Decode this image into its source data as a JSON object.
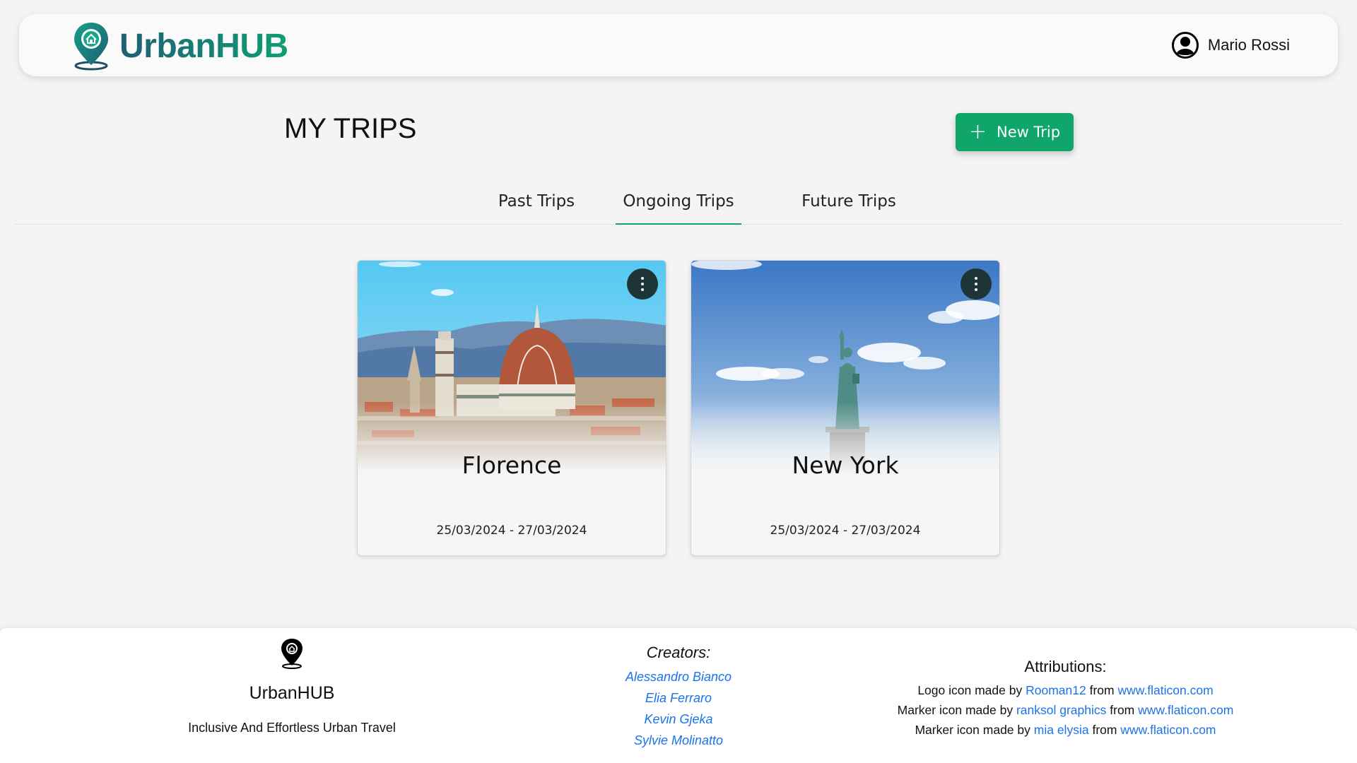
{
  "header": {
    "brand": "UrbanHUB",
    "user_name": "Mario Rossi"
  },
  "main": {
    "title": "MY TRIPS",
    "new_trip_label": "New Trip",
    "tabs": [
      {
        "label": "Past Trips",
        "active": false
      },
      {
        "label": "Ongoing Trips",
        "active": true
      },
      {
        "label": "Future Trips",
        "active": false
      }
    ],
    "trips": [
      {
        "city": "Florence",
        "dates": "25/03/2024 - 27/03/2024"
      },
      {
        "city": "New York",
        "dates": "25/03/2024 - 27/03/2024"
      }
    ]
  },
  "footer": {
    "brand": "UrbanHUB",
    "tagline": "Inclusive And Effortless Urban Travel",
    "creators_title": "Creators:",
    "creators": [
      "Alessandro Bianco",
      "Elia Ferraro",
      "Kevin Gjeka",
      "Sylvie Molinatto"
    ],
    "attributions_title": "Attributions:",
    "attributions": [
      {
        "prefix": "Logo icon made by",
        "author": "Rooman12",
        "mid": "from",
        "site": "www.flaticon.com"
      },
      {
        "prefix": "Marker icon made by",
        "author": "ranksol graphics",
        "mid": "from",
        "site": "www.flaticon.com"
      },
      {
        "prefix": "Marker icon made by",
        "author": "mia elysia",
        "mid": "from",
        "site": "www.flaticon.com"
      }
    ]
  },
  "colors": {
    "accent": "#10a66b",
    "brand_gradient_start": "#1f5f74",
    "brand_gradient_end": "#0f9e74",
    "link": "#1a73e8"
  }
}
